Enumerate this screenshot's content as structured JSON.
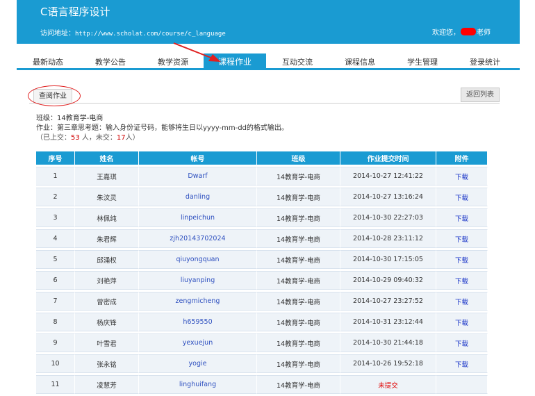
{
  "header": {
    "title": "C语言程序设计",
    "address_label": "访问地址：",
    "address_url": "http://www.scholat.com/course/c_language",
    "welcome_prefix": "欢迎您，",
    "welcome_suffix": "老师"
  },
  "nav": {
    "items": [
      "最新动态",
      "教学公告",
      "教学资源",
      "课程作业",
      "互动交流",
      "课程信息",
      "学生管理",
      "登录统计"
    ],
    "active": "课程作业"
  },
  "subtab": {
    "label": "查阅作业",
    "back_label": "返回列表"
  },
  "info": {
    "class_label": "班级：",
    "class_value": "14教育学-电商",
    "assignment_label": "作业：",
    "assignment_value": "第三章思考题：输入身份证号码，能够将生日以yyyy-mm-dd的格式输出。",
    "submitted_prefix": "（已上交：",
    "submitted_count": "53",
    "not_submitted_prefix": " 人，未交：",
    "not_submitted_count": "17",
    "suffix": "人）"
  },
  "table": {
    "headers": [
      "序号",
      "姓名",
      "帐号",
      "班级",
      "作业提交时间",
      "附件"
    ],
    "rows": [
      {
        "no": "1",
        "name": "王嘉琪",
        "account": "Dwarf",
        "class": "14教育学-电商",
        "time": "2014-10-27 12:41:22",
        "file": "下载"
      },
      {
        "no": "2",
        "name": "朱汶灵",
        "account": "danling",
        "class": "14教育学-电商",
        "time": "2014-10-27 13:16:24",
        "file": "下载"
      },
      {
        "no": "3",
        "name": "林佩纯",
        "account": "linpeichun",
        "class": "14教育学-电商",
        "time": "2014-10-30 22:27:03",
        "file": "下载"
      },
      {
        "no": "4",
        "name": "朱君辉",
        "account": "zjh20143702024",
        "class": "14教育学-电商",
        "time": "2014-10-28 23:11:12",
        "file": "下载"
      },
      {
        "no": "5",
        "name": "邱涌权",
        "account": "qiuyongquan",
        "class": "14教育学-电商",
        "time": "2014-10-30 17:15:05",
        "file": "下载"
      },
      {
        "no": "6",
        "name": "刘艳萍",
        "account": "liuyanping",
        "class": "14教育学-电商",
        "time": "2014-10-29 09:40:32",
        "file": "下载"
      },
      {
        "no": "7",
        "name": "曾密成",
        "account": "zengmicheng",
        "class": "14教育学-电商",
        "time": "2014-10-27 23:27:52",
        "file": "下载"
      },
      {
        "no": "8",
        "name": "杨庆锋",
        "account": "h659550",
        "class": "14教育学-电商",
        "time": "2014-10-31 23:12:44",
        "file": "下载"
      },
      {
        "no": "9",
        "name": "叶雪君",
        "account": "yexuejun",
        "class": "14教育学-电商",
        "time": "2014-10-30 21:44:18",
        "file": "下载"
      },
      {
        "no": "10",
        "name": "张永铭",
        "account": "yogie",
        "class": "14教育学-电商",
        "time": "2014-10-26 19:52:18",
        "file": "下载"
      },
      {
        "no": "11",
        "name": "凌慧芳",
        "account": "linghuifang",
        "class": "14教育学-电商",
        "time": "未提交",
        "file": ""
      }
    ]
  },
  "colors": {
    "accent": "#1a9bd2",
    "annotation_red": "#e02020",
    "link_blue": "#1a35c8"
  }
}
